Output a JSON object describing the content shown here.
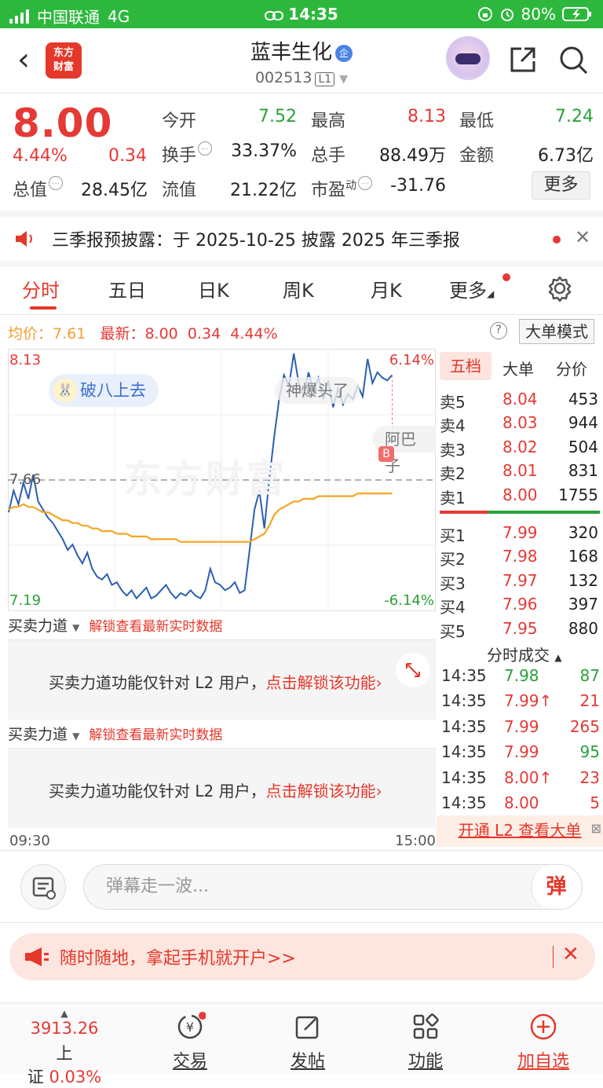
{
  "status_bar": {
    "carrier": "中国联通",
    "network": "4G",
    "time": "14:35",
    "battery": "80%"
  },
  "header": {
    "logo_text": "东方\n财富",
    "stock_name": "蓝丰生化",
    "stock_badge": "企",
    "stock_code": "002513",
    "level": "L1"
  },
  "quote": {
    "price": "8.00",
    "change_pct": "4.44%",
    "change": "0.34",
    "open_label": "今开",
    "open": "7.52",
    "high_label": "最高",
    "high": "8.13",
    "low_label": "最低",
    "low": "7.24",
    "turnover_label": "换手",
    "turnover": "33.37%",
    "volume_label": "总手",
    "volume": "88.49万",
    "amount_label": "金额",
    "amount": "6.73亿",
    "mktcap_label": "总值",
    "mktcap": "28.45亿",
    "float_label": "流值",
    "float_cap": "21.22亿",
    "pe_label": "市盈",
    "pe_sup": "动",
    "pe": "-31.76",
    "more_label": "更多"
  },
  "notice": {
    "text": "三季报预披露：于 2025-10-25 披露 2025 年三季报",
    "close": "✕"
  },
  "tabs": [
    "分时",
    "五日",
    "日K",
    "周K",
    "月K",
    "更多"
  ],
  "avg_line": {
    "avg_label": "均价：",
    "avg": "7.61",
    "latest_label": "最新：",
    "latest": "8.00",
    "chg": "0.34",
    "pct": "4.44%",
    "help": "?",
    "big_mode": "大单模式"
  },
  "chart_data": {
    "type": "line",
    "title": "",
    "y_top": "8.13",
    "y_bottom": "7.19",
    "y_ref": "7.66",
    "pct_top": "6.14%",
    "pct_bottom": "-6.14%",
    "ylim": [
      7.19,
      8.13
    ],
    "x_start": "09:30",
    "x_end": "15:00",
    "watermark": "东方财富",
    "tag_bubble": "破八上去",
    "comment_1": "神爆头了",
    "comment_2": "阿巴子",
    "marker": "B",
    "series": [
      {
        "name": "price",
        "values": [
          7.54,
          7.62,
          7.57,
          7.65,
          7.59,
          7.68,
          7.58,
          7.55,
          7.52,
          7.5,
          7.47,
          7.44,
          7.4,
          7.42,
          7.38,
          7.35,
          7.39,
          7.33,
          7.3,
          7.29,
          7.31,
          7.27,
          7.28,
          7.25,
          7.23,
          7.25,
          7.22,
          7.24,
          7.26,
          7.22,
          7.23,
          7.25,
          7.27,
          7.24,
          7.22,
          7.24,
          7.23,
          7.25,
          7.23,
          7.22,
          7.25,
          7.33,
          7.28,
          7.27,
          7.25,
          7.26,
          7.28,
          7.24,
          7.25,
          7.4,
          7.55,
          7.62,
          7.48,
          7.66,
          7.82,
          7.96,
          8.05,
          8.01,
          8.13,
          8.02,
          7.97,
          8.06,
          7.99,
          8.04,
          7.96,
          8.03,
          7.93,
          8.0,
          7.94,
          7.98,
          7.96,
          8.01,
          7.97,
          8.11,
          8.02,
          8.06,
          8.04,
          8.03,
          8.05
        ]
      },
      {
        "name": "avg",
        "values": [
          7.55,
          7.56,
          7.56,
          7.57,
          7.56,
          7.56,
          7.55,
          7.54,
          7.54,
          7.53,
          7.52,
          7.51,
          7.51,
          7.5,
          7.5,
          7.49,
          7.49,
          7.48,
          7.48,
          7.47,
          7.47,
          7.47,
          7.46,
          7.46,
          7.46,
          7.45,
          7.45,
          7.45,
          7.45,
          7.44,
          7.44,
          7.44,
          7.44,
          7.44,
          7.44,
          7.43,
          7.43,
          7.43,
          7.43,
          7.43,
          7.43,
          7.43,
          7.43,
          7.43,
          7.43,
          7.43,
          7.43,
          7.43,
          7.43,
          7.43,
          7.44,
          7.45,
          7.46,
          7.49,
          7.53,
          7.55,
          7.56,
          7.57,
          7.58,
          7.58,
          7.59,
          7.59,
          7.59,
          7.6,
          7.6,
          7.6,
          7.6,
          7.6,
          7.6,
          7.6,
          7.6,
          7.61,
          7.61,
          7.61,
          7.61,
          7.61,
          7.61,
          7.61,
          7.61
        ]
      }
    ]
  },
  "pankou": {
    "tabs": [
      "五档",
      "大单",
      "分价"
    ],
    "sell": [
      {
        "label": "卖5",
        "price": "8.04",
        "vol": "453"
      },
      {
        "label": "卖4",
        "price": "8.03",
        "vol": "944"
      },
      {
        "label": "卖3",
        "price": "8.02",
        "vol": "504"
      },
      {
        "label": "卖2",
        "price": "8.01",
        "vol": "831"
      },
      {
        "label": "卖1",
        "price": "8.00",
        "vol": "1755"
      }
    ],
    "buy": [
      {
        "label": "买1",
        "price": "7.99",
        "vol": "320"
      },
      {
        "label": "买2",
        "price": "7.98",
        "vol": "168"
      },
      {
        "label": "买3",
        "price": "7.97",
        "vol": "132"
      },
      {
        "label": "买4",
        "price": "7.96",
        "vol": "397"
      },
      {
        "label": "买5",
        "price": "7.95",
        "vol": "880"
      }
    ]
  },
  "flow": {
    "title": "买卖力道",
    "unlock_link": "解锁查看最新实时数据",
    "msg": "买卖力道功能仅针对 L2 用户，",
    "msg_link": "点击解锁该功能›"
  },
  "trades": {
    "title": "分时成交",
    "rows": [
      {
        "time": "14:35",
        "price": "7.98",
        "vol": "87",
        "pc": "green",
        "vc": "green"
      },
      {
        "time": "14:35",
        "price": "7.99↑",
        "vol": "21",
        "pc": "red",
        "vc": "red"
      },
      {
        "time": "14:35",
        "price": "7.99",
        "vol": "265",
        "pc": "red",
        "vc": "red"
      },
      {
        "time": "14:35",
        "price": "7.99",
        "vol": "95",
        "pc": "red",
        "vc": "green"
      },
      {
        "time": "14:35",
        "price": "8.00↑",
        "vol": "23",
        "pc": "red",
        "vc": "red"
      },
      {
        "time": "14:35",
        "price": "8.00",
        "vol": "5",
        "pc": "red",
        "vc": "red"
      }
    ],
    "l2_link": "开通 L2 查看大单"
  },
  "danmu": {
    "placeholder": "弹幕走一波...",
    "button": "弹"
  },
  "promo": {
    "text": "随时随地，拿起手机就开户>>",
    "close": "✕"
  },
  "tabbar": {
    "index_value": "3913.26",
    "index_name": "上证",
    "index_pct": "0.03%",
    "trade": "交易",
    "post": "发帖",
    "func": "功能",
    "watch": "加自选"
  },
  "colors": {
    "up": "#e53935",
    "down": "#2aa13b",
    "accent": "#e5372a",
    "price_line": "#2b5fb3",
    "avg_line": "#f5a623"
  }
}
